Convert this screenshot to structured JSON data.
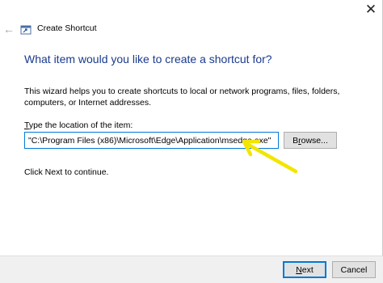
{
  "window": {
    "title": "Create Shortcut",
    "close_glyph": "✕",
    "back_glyph": "←"
  },
  "main": {
    "heading": "What item would you like to create a shortcut for?",
    "description": "This wizard helps you to create shortcuts to local or network programs, files, folders, computers, or Internet addresses.",
    "location_label_access_key": "T",
    "location_label_rest": "ype the location of the item:",
    "location_value": "\"C:\\Program Files (x86)\\Microsoft\\Edge\\Application\\msedge.exe\"",
    "browse_access_key": "r",
    "browse_prefix": "B",
    "browse_suffix": "owse...",
    "hint": "Click Next to continue."
  },
  "footer": {
    "next_access_key": "N",
    "next_rest": "ext",
    "cancel_label": "Cancel"
  },
  "colors": {
    "heading": "#1a3a8c",
    "focus_border": "#0078d7",
    "arrow": "#f2e600",
    "footer_bg": "#f0f0f0"
  },
  "icons": {
    "back": "back-arrow-icon",
    "close": "close-icon",
    "app": "shortcut-wizard-icon",
    "annotation": "yellow-arrow-annotation"
  }
}
